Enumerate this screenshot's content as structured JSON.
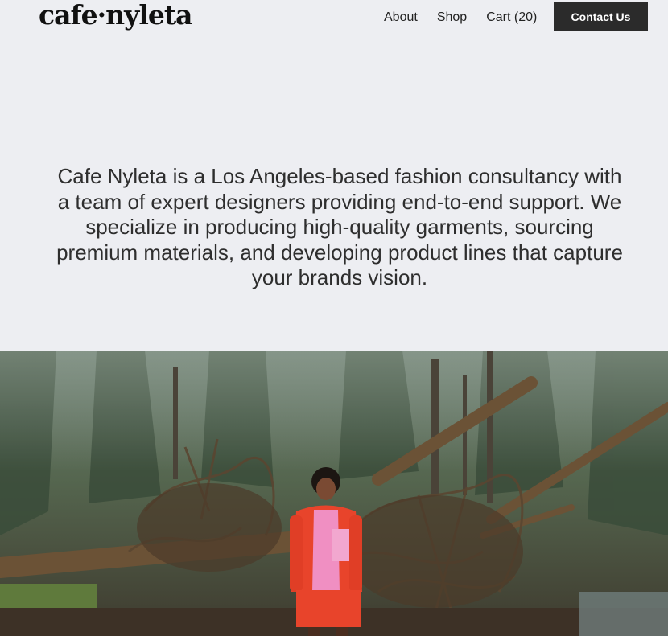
{
  "header": {
    "logo": "cafe·nyleta",
    "nav": [
      {
        "label": "About"
      },
      {
        "label": "Shop"
      },
      {
        "label": "Cart (20)"
      }
    ],
    "contact_label": "Contact Us"
  },
  "intro": {
    "text": "Cafe Nyleta is a Los Angeles-based fashion consultancy with a team of expert designers providing end-to-end support. We specialize in producing high-quality garments, sourcing premium materials, and developing product lines that capture your brands vision."
  },
  "colors": {
    "background": "#edeef2",
    "button": "#2b2b2b",
    "jacket": "#e8442b",
    "shirt": "#f08fc2"
  }
}
